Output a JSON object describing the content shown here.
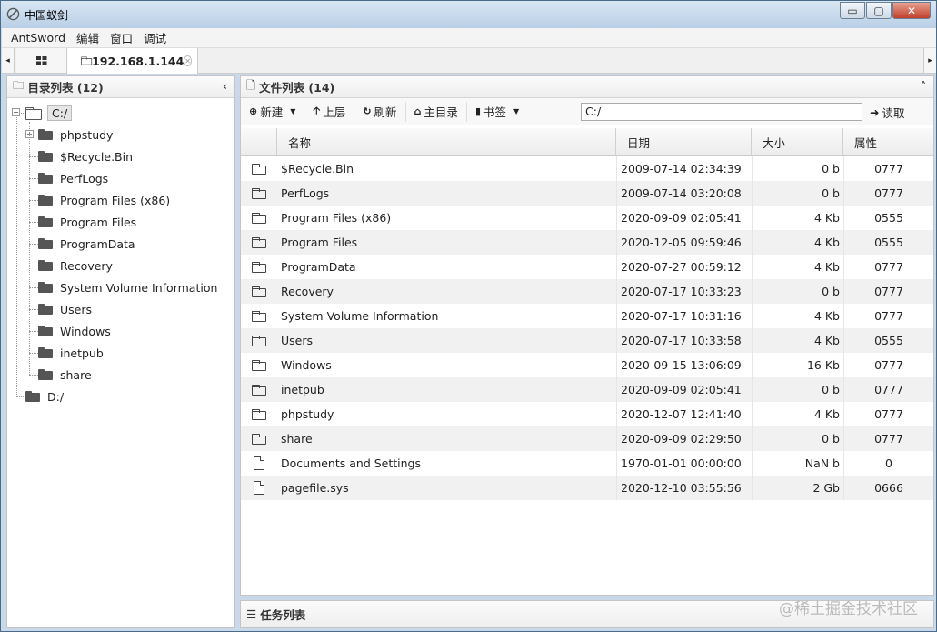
{
  "window": {
    "title": "中国蚁剑",
    "controls": [
      "▭",
      "▢",
      "✕"
    ]
  },
  "menu": [
    "AntSword",
    "编辑",
    "窗口",
    "调试"
  ],
  "tabs": {
    "left_arrow": "◂",
    "right_arrow": "▸",
    "active": "192.168.1.144"
  },
  "dir_panel": {
    "title": "目录列表 (12)",
    "tree": [
      {
        "label": "C:/",
        "level": 0,
        "open": true,
        "selected": true
      },
      {
        "label": "phpstudy",
        "level": 1,
        "expandable": true
      },
      {
        "label": "$Recycle.Bin",
        "level": 1
      },
      {
        "label": "PerfLogs",
        "level": 1
      },
      {
        "label": "Program Files (x86)",
        "level": 1
      },
      {
        "label": "Program Files",
        "level": 1
      },
      {
        "label": "ProgramData",
        "level": 1
      },
      {
        "label": "Recovery",
        "level": 1
      },
      {
        "label": "System Volume Information",
        "level": 1
      },
      {
        "label": "Users",
        "level": 1
      },
      {
        "label": "Windows",
        "level": 1
      },
      {
        "label": "inetpub",
        "level": 1
      },
      {
        "label": "share",
        "level": 1
      },
      {
        "label": "D:/",
        "level": 0
      }
    ]
  },
  "file_panel": {
    "title": "文件列表 (14)",
    "toolbar": {
      "new": "新建",
      "up": "上层",
      "refresh": "刷新",
      "home": "主目录",
      "bookmark": "书签",
      "path": "C:/",
      "read": "读取"
    },
    "columns": [
      "名称",
      "日期",
      "大小",
      "属性"
    ],
    "rows": [
      {
        "type": "folder",
        "name": "$Recycle.Bin",
        "date": "2009-07-14 02:34:39",
        "size": "0 b",
        "attr": "0777"
      },
      {
        "type": "folder",
        "name": "PerfLogs",
        "date": "2009-07-14 03:20:08",
        "size": "0 b",
        "attr": "0777"
      },
      {
        "type": "folder",
        "name": "Program Files (x86)",
        "date": "2020-09-09 02:05:41",
        "size": "4 Kb",
        "attr": "0555"
      },
      {
        "type": "folder",
        "name": "Program Files",
        "date": "2020-12-05 09:59:46",
        "size": "4 Kb",
        "attr": "0555"
      },
      {
        "type": "folder",
        "name": "ProgramData",
        "date": "2020-07-27 00:59:12",
        "size": "4 Kb",
        "attr": "0777"
      },
      {
        "type": "folder",
        "name": "Recovery",
        "date": "2020-07-17 10:33:23",
        "size": "0 b",
        "attr": "0777"
      },
      {
        "type": "folder",
        "name": "System Volume Information",
        "date": "2020-07-17 10:31:16",
        "size": "4 Kb",
        "attr": "0777"
      },
      {
        "type": "folder",
        "name": "Users",
        "date": "2020-07-17 10:33:58",
        "size": "4 Kb",
        "attr": "0555"
      },
      {
        "type": "folder",
        "name": "Windows",
        "date": "2020-09-15 13:06:09",
        "size": "16 Kb",
        "attr": "0777"
      },
      {
        "type": "folder",
        "name": "inetpub",
        "date": "2020-09-09 02:05:41",
        "size": "0 b",
        "attr": "0777"
      },
      {
        "type": "folder",
        "name": "phpstudy",
        "date": "2020-12-07 12:41:40",
        "size": "4 Kb",
        "attr": "0777"
      },
      {
        "type": "folder",
        "name": "share",
        "date": "2020-09-09 02:29:50",
        "size": "0 b",
        "attr": "0777"
      },
      {
        "type": "file",
        "name": "Documents and Settings",
        "date": "1970-01-01 00:00:00",
        "size": "NaN b",
        "attr": "0"
      },
      {
        "type": "file",
        "name": "pagefile.sys",
        "date": "2020-12-10 03:55:56",
        "size": "2 Gb",
        "attr": "0666"
      }
    ]
  },
  "task_panel": {
    "title": "任务列表"
  },
  "watermark": "@稀土掘金技术社区"
}
